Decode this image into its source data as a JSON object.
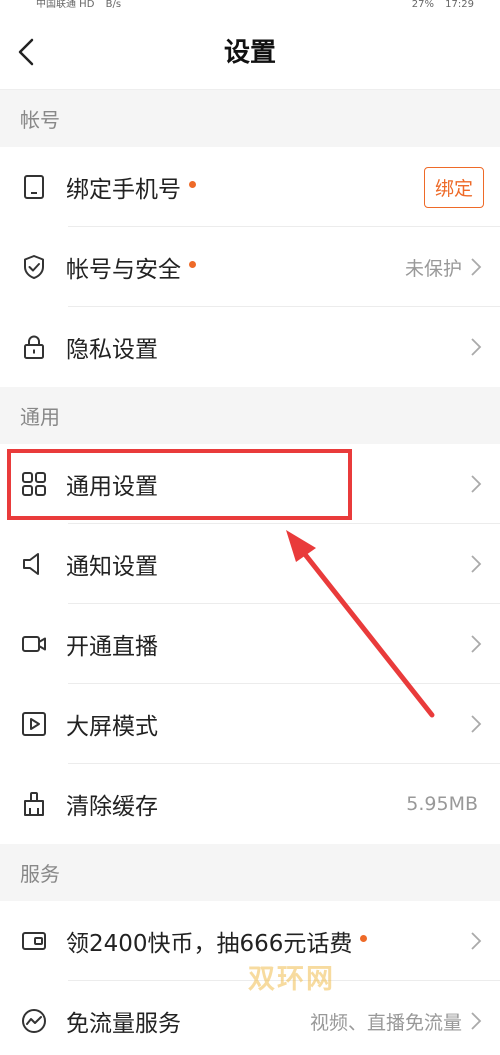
{
  "statusbar": {
    "carrier": "中国联通 HD",
    "net": "B/s",
    "battery": "27%",
    "time": "17:29"
  },
  "header": {
    "title": "设置"
  },
  "sections": {
    "account": {
      "title": "帐号",
      "bind_phone": {
        "label": "绑定手机号",
        "button": "绑定"
      },
      "security": {
        "label": "帐号与安全",
        "value": "未保护"
      },
      "privacy": {
        "label": "隐私设置"
      }
    },
    "general": {
      "title": "通用",
      "general_settings": {
        "label": "通用设置"
      },
      "notification": {
        "label": "通知设置"
      },
      "live": {
        "label": "开通直播"
      },
      "bigscreen": {
        "label": "大屏模式"
      },
      "cache": {
        "label": "清除缓存",
        "value": "5.95MB"
      }
    },
    "services": {
      "title": "服务",
      "coins": {
        "label": "领2400快币，抽666元话费"
      },
      "free_traffic": {
        "label": "免流量服务",
        "value": "视频、直播免流量"
      }
    }
  },
  "watermark": "双环网",
  "colors": {
    "accent": "#ee6a28",
    "highlight": "#e93b3b"
  }
}
